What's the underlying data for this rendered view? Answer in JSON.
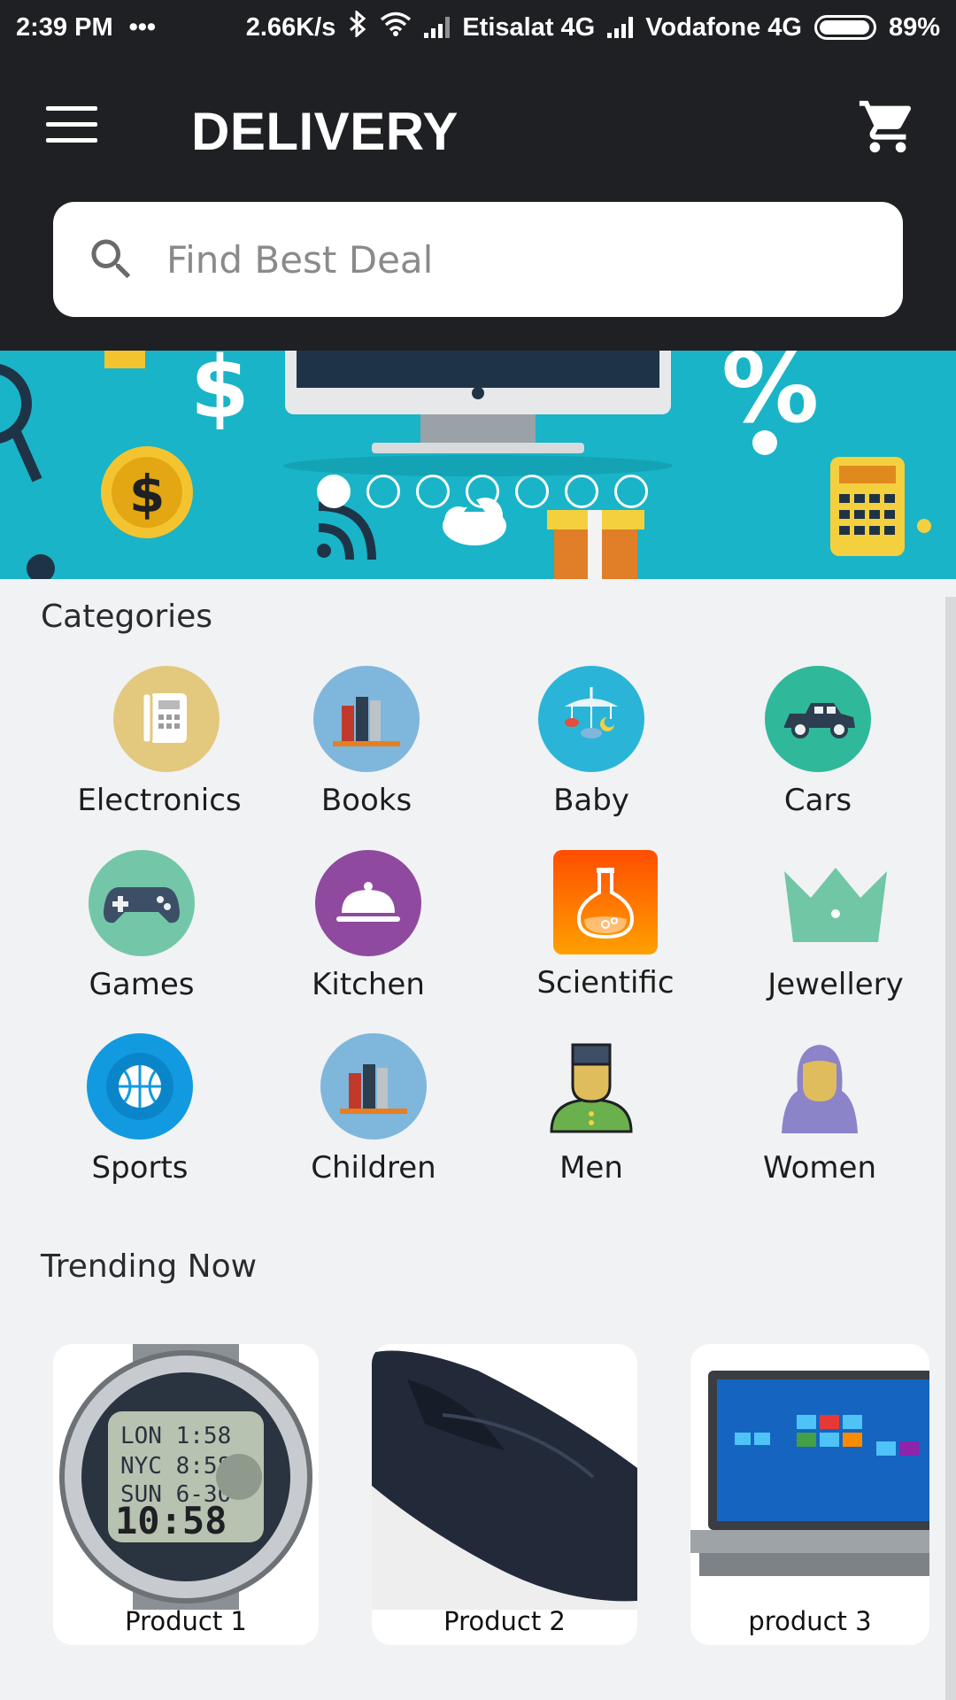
{
  "status_bar": {
    "time": "2:39 PM",
    "dots": "•••",
    "speed": "2.66K/s",
    "carrier1": "Etisalat 4G",
    "carrier2": "Vodafone 4G",
    "battery": "89%"
  },
  "header": {
    "title": "DELIVERY"
  },
  "search": {
    "placeholder": "Find Best Deal"
  },
  "banner": {
    "slides": 7,
    "active_slide": 1
  },
  "categories": {
    "title": "Categories",
    "items": [
      {
        "label": "Electronics",
        "icon": "telephone-icon",
        "color": "#e3c97e"
      },
      {
        "label": "Books",
        "icon": "books-icon",
        "color": "#7fb7dc"
      },
      {
        "label": "Baby",
        "icon": "baby-mobile-icon",
        "color": "#2ab5d8"
      },
      {
        "label": "Cars",
        "icon": "car-icon",
        "color": "#30b89b"
      },
      {
        "label": "Games",
        "icon": "gamepad-icon",
        "color": "#73c7a8"
      },
      {
        "label": "Kitchen",
        "icon": "cloche-icon",
        "color": "#8f4aa0"
      },
      {
        "label": "Scientific",
        "icon": "flask-icon",
        "color": "#ff6a00"
      },
      {
        "label": "Jewellery",
        "icon": "crown-icon",
        "color": "#71c6a5"
      },
      {
        "label": "Sports",
        "icon": "basketball-icon",
        "color": "#129ae1"
      },
      {
        "label": "Children",
        "icon": "books-icon",
        "color": "#7fb7dc"
      },
      {
        "label": "Men",
        "icon": "man-icon",
        "color": "#6ab04c"
      },
      {
        "label": "Women",
        "icon": "woman-icon",
        "color": "#8b84c8"
      }
    ]
  },
  "trending": {
    "title": "Trending Now",
    "products": [
      {
        "name": "Product 1",
        "icon": "watch-icon"
      },
      {
        "name": "Product 2",
        "icon": "shoe-icon"
      },
      {
        "name": "product 3",
        "icon": "laptop-icon"
      }
    ]
  },
  "colors": {
    "appbar": "#1f2024",
    "banner": "#19b4c7",
    "background": "#f1f2f4"
  }
}
